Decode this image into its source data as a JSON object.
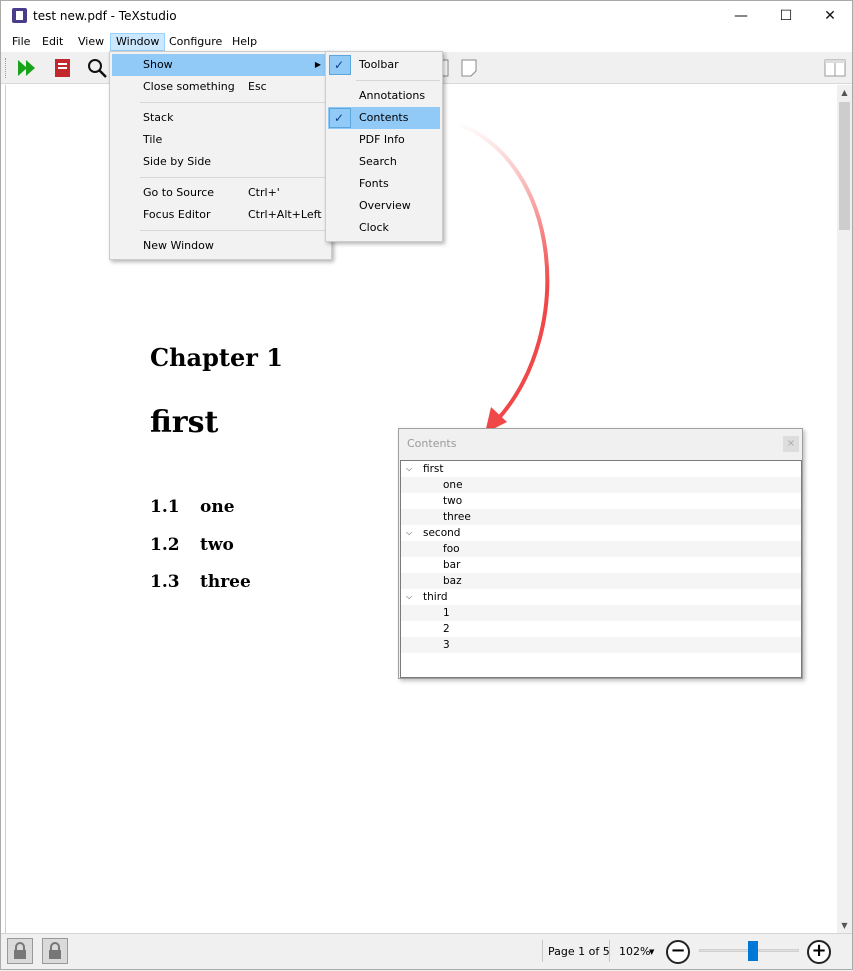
{
  "window": {
    "title": "test new.pdf - TeXstudio",
    "controls": {
      "minimize": "—",
      "maximize": "☐",
      "close": "✕"
    }
  },
  "menubar": {
    "items": [
      "File",
      "Edit",
      "View",
      "Window",
      "Configure",
      "Help"
    ],
    "active": "Window"
  },
  "window_menu": {
    "items": [
      {
        "label": "Show",
        "shortcut": "",
        "submenu": true
      },
      {
        "label": "Close something",
        "shortcut": "Esc"
      },
      {
        "label": "Stack",
        "shortcut": ""
      },
      {
        "label": "Tile",
        "shortcut": ""
      },
      {
        "label": "Side by Side",
        "shortcut": ""
      },
      {
        "label": "Go to Source",
        "shortcut": "Ctrl+'"
      },
      {
        "label": "Focus Editor",
        "shortcut": "Ctrl+Alt+Left"
      },
      {
        "label": "New Window",
        "shortcut": ""
      }
    ]
  },
  "show_submenu": {
    "items": [
      {
        "label": "Toolbar",
        "checked": true
      },
      {
        "label": "Annotations",
        "checked": false
      },
      {
        "label": "Contents",
        "checked": true
      },
      {
        "label": "PDF Info",
        "checked": false
      },
      {
        "label": "Search",
        "checked": false
      },
      {
        "label": "Fonts",
        "checked": false
      },
      {
        "label": "Overview",
        "checked": false
      },
      {
        "label": "Clock",
        "checked": false
      }
    ]
  },
  "pdf": {
    "chapter": "Chapter 1",
    "chapter_title": "first",
    "sections": [
      {
        "num": "1.1",
        "title": "one"
      },
      {
        "num": "1.2",
        "title": "two"
      },
      {
        "num": "1.3",
        "title": "three"
      }
    ]
  },
  "contents_panel": {
    "title": "Contents",
    "close_glyph": "×",
    "tree": [
      {
        "label": "first",
        "level": 0
      },
      {
        "label": "one",
        "level": 1
      },
      {
        "label": "two",
        "level": 1
      },
      {
        "label": "three",
        "level": 1
      },
      {
        "label": "second",
        "level": 0
      },
      {
        "label": "foo",
        "level": 1
      },
      {
        "label": "bar",
        "level": 1
      },
      {
        "label": "baz",
        "level": 1
      },
      {
        "label": "third",
        "level": 0
      },
      {
        "label": "1",
        "level": 1
      },
      {
        "label": "2",
        "level": 1
      },
      {
        "label": "3",
        "level": 1
      }
    ]
  },
  "statusbar": {
    "page_info": "Page 1 of 5",
    "zoom": "102%",
    "zoom_out": "−",
    "zoom_in": "+",
    "zoom_slider_fraction": 0.5
  },
  "colors": {
    "menu_highlight": "#91c9f7",
    "annotation_arrow": "#f04848",
    "slider_thumb": "#0078d7"
  }
}
